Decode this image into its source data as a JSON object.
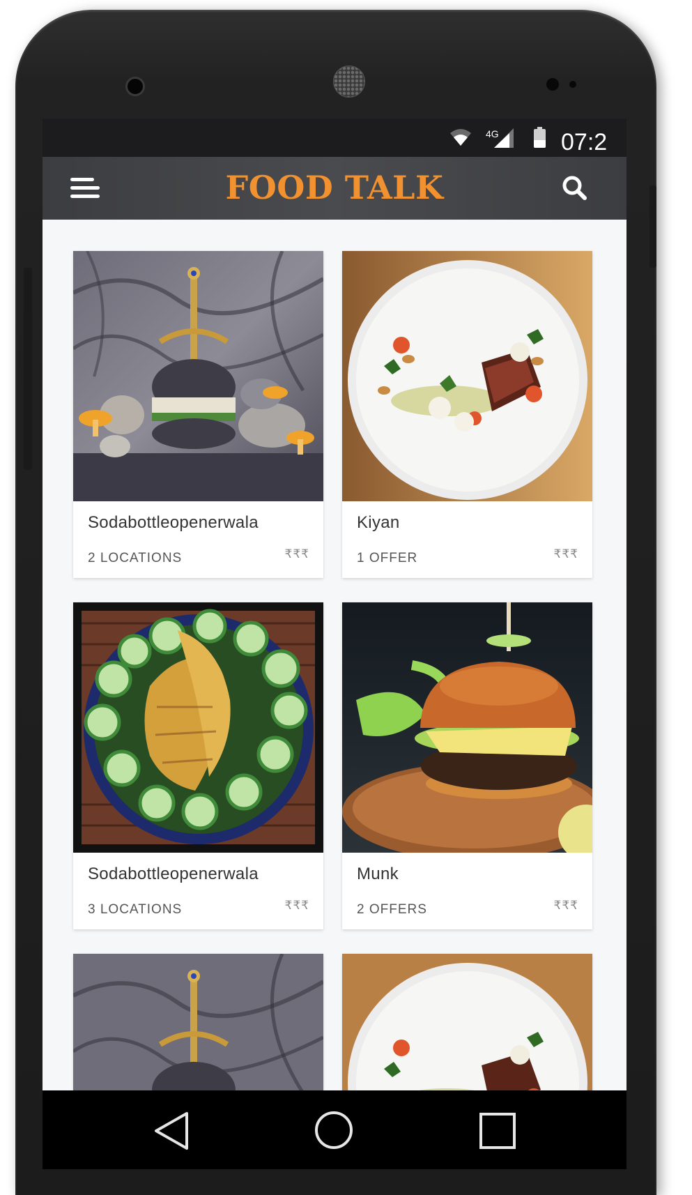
{
  "status_bar": {
    "network_label": "4G",
    "time": "07:2",
    "icons": [
      "wifi-icon",
      "cellular-signal-icon",
      "battery-icon"
    ]
  },
  "app_bar": {
    "title": "FOOD TALK",
    "title_color": "#f2912f",
    "menu_icon": "hamburger-menu-icon",
    "search_icon": "search-icon"
  },
  "restaurants": [
    {
      "name": "Sodabottleopenerwala",
      "detail": "2 LOCATIONS",
      "price": "₹₹₹",
      "photo": "black-burger-with-sword-and-mushrooms"
    },
    {
      "name": "Kiyan",
      "detail": "1 OFFER",
      "price": "₹₹₹",
      "photo": "steak-plate-with-vegetables"
    },
    {
      "name": "Sodabottleopenerwala",
      "detail": "3 LOCATIONS",
      "price": "₹₹₹",
      "photo": "grilled-fish-with-cucumber-slices"
    },
    {
      "name": "Munk",
      "detail": "2 OFFERS",
      "price": "₹₹₹",
      "photo": "burger-with-cheese-on-wooden-board"
    },
    {
      "name": "",
      "detail": "",
      "price": "",
      "photo": "black-burger-with-sword-and-mushrooms"
    },
    {
      "name": "",
      "detail": "",
      "price": "",
      "photo": "steak-plate-with-vegetables"
    }
  ],
  "nav_bar": {
    "icons": [
      "back-icon",
      "home-icon",
      "recent-apps-icon"
    ]
  }
}
